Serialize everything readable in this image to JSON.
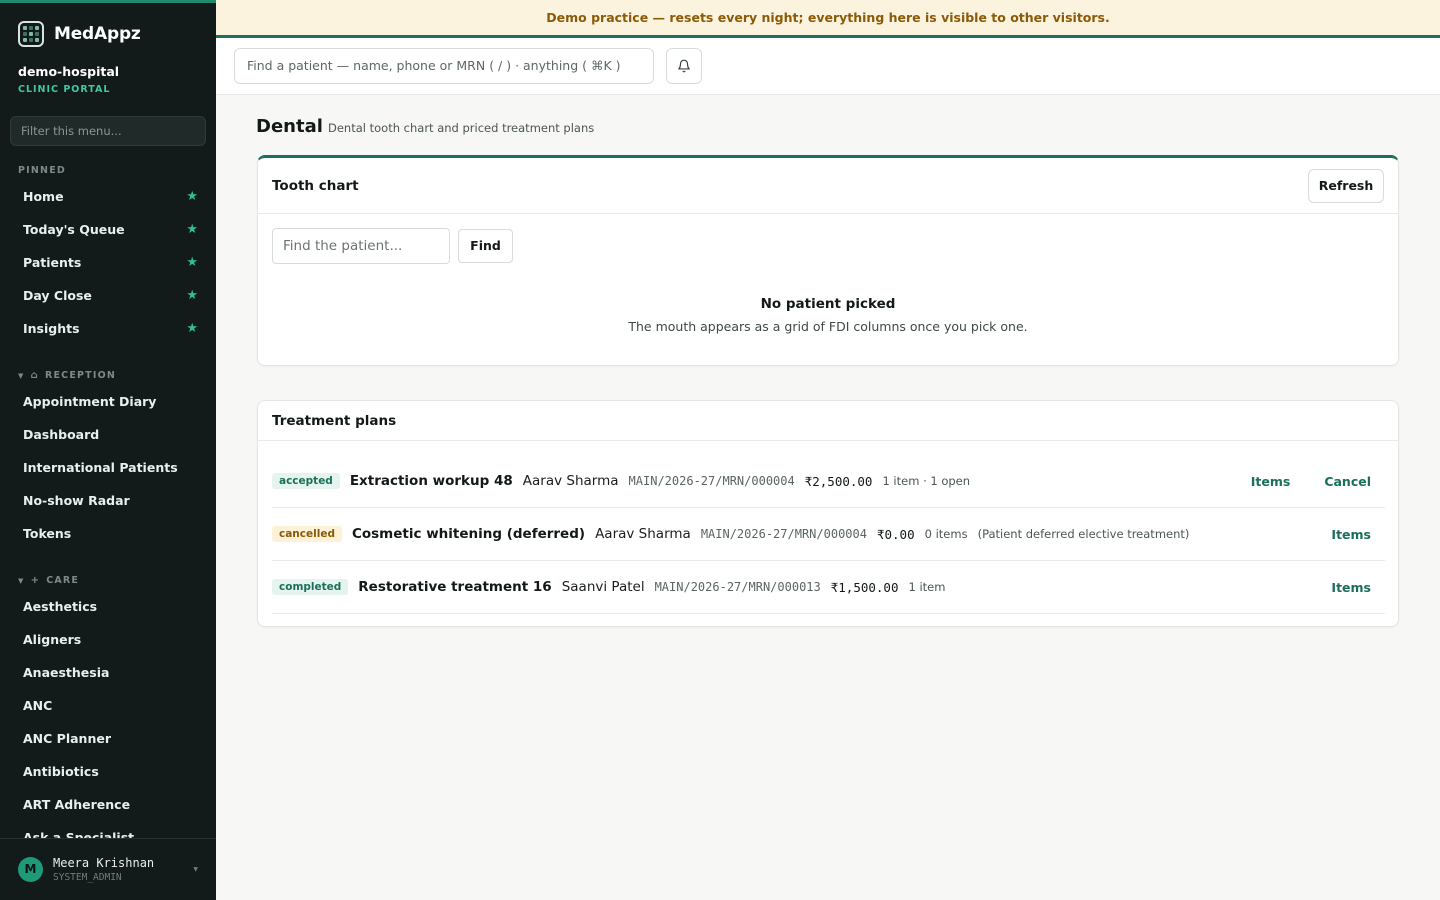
{
  "brand": {
    "name": "MedAppz"
  },
  "tenant": {
    "name": "demo-hospital",
    "subtitle": "CLINIC PORTAL"
  },
  "sidebar": {
    "filter_placeholder": "Filter this menu...",
    "pinned_label": "PINNED",
    "pinned": [
      {
        "label": "Home"
      },
      {
        "label": "Today's Queue"
      },
      {
        "label": "Patients"
      },
      {
        "label": "Day Close"
      },
      {
        "label": "Insights"
      }
    ],
    "reception_label": "RECEPTION",
    "reception": [
      {
        "label": "Appointment Diary"
      },
      {
        "label": "Dashboard"
      },
      {
        "label": "International Patients"
      },
      {
        "label": "No-show Radar"
      },
      {
        "label": "Tokens"
      }
    ],
    "care_label": "CARE",
    "care": [
      {
        "label": "Aesthetics"
      },
      {
        "label": "Aligners"
      },
      {
        "label": "Anaesthesia"
      },
      {
        "label": "ANC"
      },
      {
        "label": "ANC Planner"
      },
      {
        "label": "Antibiotics"
      },
      {
        "label": "ART Adherence"
      },
      {
        "label": "Ask a Specialist"
      }
    ],
    "pin_icon": "star-icon"
  },
  "user": {
    "initial": "M",
    "name": "Meera Krishnan",
    "role": "SYSTEM_ADMIN"
  },
  "banner": {
    "text": "Demo practice — resets every night; everything here is visible to other visitors."
  },
  "topbar": {
    "search_placeholder": "Find a patient — name, phone or MRN ( / ) · anything ( ⌘K )"
  },
  "page": {
    "title": "Dental",
    "subtitle": "Dental tooth chart and priced treatment plans"
  },
  "tooth_chart": {
    "title": "Tooth chart",
    "refresh_label": "Refresh",
    "find_placeholder": "Find the patient...",
    "find_label": "Find",
    "empty_title": "No patient picked",
    "empty_sub": "The mouth appears as a grid of FDI columns once you pick one."
  },
  "treatment_plans": {
    "title": "Treatment plans",
    "rows": [
      {
        "status": "accepted",
        "title": "Extraction workup 48",
        "patient": "Aarav Sharma",
        "mrn": "MAIN/2026-27/MRN/000004",
        "amount": "₹2,500.00",
        "meta": "1 item · 1 open",
        "note": "",
        "items_label": "Items",
        "cancel_label": "Cancel"
      },
      {
        "status": "cancelled",
        "title": "Cosmetic whitening (deferred)",
        "patient": "Aarav Sharma",
        "mrn": "MAIN/2026-27/MRN/000004",
        "amount": "₹0.00",
        "meta": "0 items",
        "note": "(Patient deferred elective treatment)",
        "items_label": "Items"
      },
      {
        "status": "completed",
        "title": "Restorative treatment 16",
        "patient": "Saanvi Patel",
        "mrn": "MAIN/2026-27/MRN/000013",
        "amount": "₹1,500.00",
        "meta": "1 item",
        "note": "",
        "items_label": "Items"
      }
    ]
  },
  "colors": {
    "sidebar_bg": "#121b1a",
    "accent": "#1f6f5d",
    "star": "#2fbf92",
    "banner_bg": "#fbf3de",
    "banner_text": "#8a5a08"
  }
}
